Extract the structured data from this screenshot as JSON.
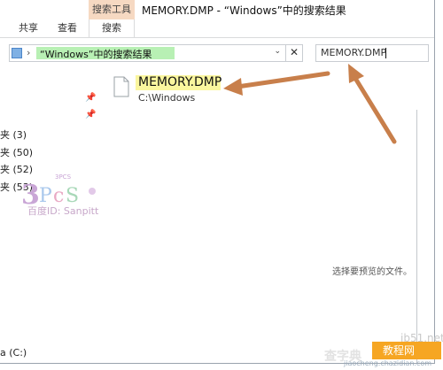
{
  "window": {
    "title": "MEMORY.DMP - “Windows”中的搜索结果",
    "context_tab": "搜索工具"
  },
  "ribbon": {
    "tabs": [
      {
        "label": "共享",
        "active": false
      },
      {
        "label": "查看",
        "active": false
      },
      {
        "label": "搜索",
        "active": true
      }
    ]
  },
  "address_bar": {
    "chevron": "›",
    "path": "“Windows”中的搜索结果",
    "dropdown_glyph": "⌄",
    "close_glyph": "✕"
  },
  "search": {
    "value": "MEMORY.DMP"
  },
  "nav": {
    "pin_glyph": "📌",
    "items": [
      {
        "label": "夹 (3)"
      },
      {
        "label": "夹 (50)"
      },
      {
        "label": "夹 (52)"
      },
      {
        "label": "夹 (53)"
      }
    ],
    "drive_label": "a (C:)"
  },
  "watermark_logo": {
    "badge": "3PCS",
    "caption": "百度ID: Sanpitt"
  },
  "results": [
    {
      "name": "MEMORY.DMP",
      "location": "C:\\Windows"
    }
  ],
  "preview": {
    "message": "选择要预览的文件。"
  },
  "site_watermark": {
    "domain": "jb51.net",
    "badge_text": "教程网",
    "big_text": "查字典",
    "sub_text": "jiaocheng.chazidian.com"
  },
  "colors": {
    "arrow": "#c87f4b",
    "address_highlight": "#b8f0b4",
    "filename_highlight": "#faf69e",
    "context_tab": "#f6d9c2"
  }
}
